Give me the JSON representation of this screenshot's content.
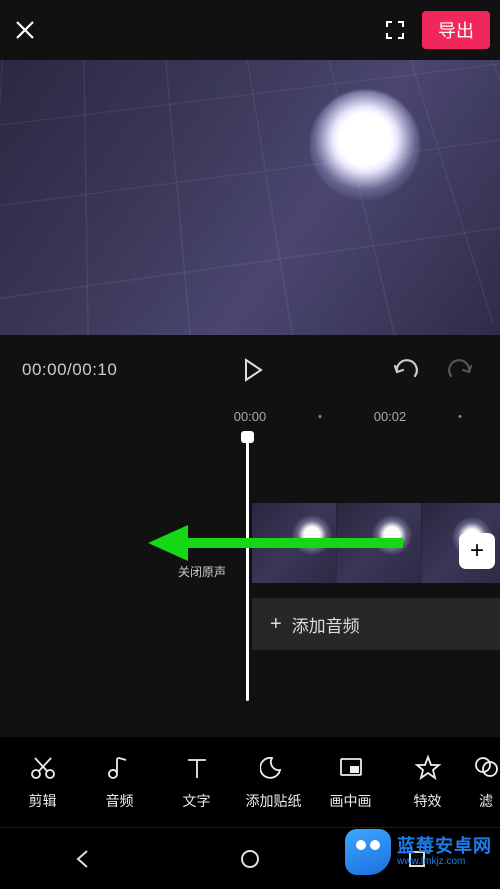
{
  "topbar": {
    "export_label": "导出"
  },
  "transport": {
    "current_time": "00:00",
    "total_time": "00:10"
  },
  "ruler": {
    "t0": "00:00",
    "t1": "00:02"
  },
  "timeline": {
    "mute_label": "关闭原声",
    "add_audio_label": "添加音频"
  },
  "tools": [
    {
      "name": "edit",
      "label": "剪辑"
    },
    {
      "name": "audio",
      "label": "音频"
    },
    {
      "name": "text",
      "label": "文字"
    },
    {
      "name": "sticker",
      "label": "添加贴纸"
    },
    {
      "name": "pip",
      "label": "画中画"
    },
    {
      "name": "effects",
      "label": "特效"
    },
    {
      "name": "filter",
      "label": "滤"
    }
  ],
  "watermark": {
    "title": "蓝莓安卓网",
    "url": "www.lmkjz.com"
  }
}
